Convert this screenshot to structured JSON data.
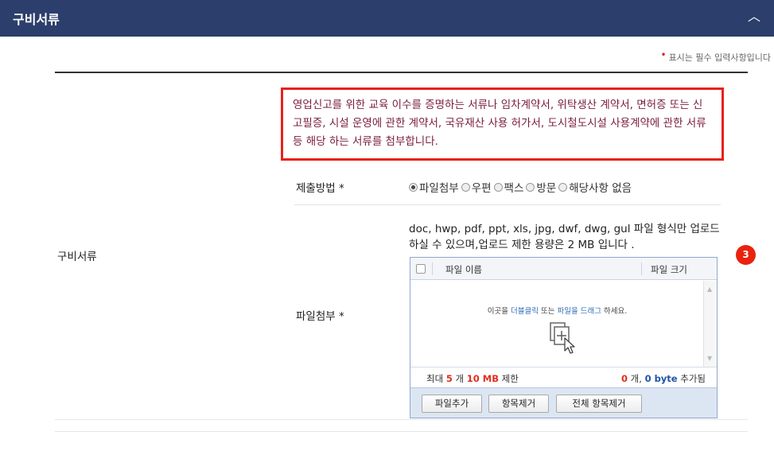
{
  "header": {
    "title": "구비서류",
    "toggle_icon": "chevron-up-icon",
    "toggle_glyph": "︿",
    "background": "#2c3e6b"
  },
  "required_note": {
    "marker": "•",
    "text": "표시는 필수 입력사항입니다"
  },
  "notice": {
    "text": "영업신고를 위한 교육 이수를 증명하는 서류나 임차계약서, 위탁생산 계약서, 면허증 또는 신고필증, 시설 운영에 관한 계약서, 국유재산 사용 허가서, 도시철도시설 사용계약에 관한 서류 등 해당 하는 서류를 첨부합니다.",
    "border_color": "#e8211c"
  },
  "section_label": "구비서류",
  "submission": {
    "label": "제출방법 *",
    "options": [
      {
        "label": "파일첨부",
        "selected": true
      },
      {
        "label": "우편",
        "selected": false
      },
      {
        "label": "팩스",
        "selected": false
      },
      {
        "label": "방문",
        "selected": false
      },
      {
        "label": "해당사항 없음",
        "selected": false
      }
    ]
  },
  "attachment": {
    "label": "파일첨부 *",
    "info_text": "doc, hwp, pdf, ppt, xls, jpg, dwf, dwg, gul 파일 형식만 업로드 하실 수 있으며,업로드 제한 용량은 2 MB 입니다 .",
    "badge": "3"
  },
  "uploader": {
    "col_name": "파일 이름",
    "col_size": "파일 크기",
    "drop_msg_prefix": "이곳을 ",
    "drop_msg_dblclick": "더블클릭",
    "drop_msg_mid": " 또는 ",
    "drop_msg_drag": "파일을 드래그",
    "drop_msg_suffix": " 하세요.",
    "drop_icon": "file-add-icon",
    "limit_prefix": "최대",
    "limit_count": "5",
    "limit_unit": "개",
    "limit_size": "10 MB",
    "limit_suffix": "제한",
    "added_count": "0",
    "added_unit": "개,",
    "added_bytes": "0 byte",
    "added_suffix": "추가됨",
    "buttons": {
      "add": "파일추가",
      "remove": "항목제거",
      "remove_all": "전체 항목제거"
    }
  }
}
